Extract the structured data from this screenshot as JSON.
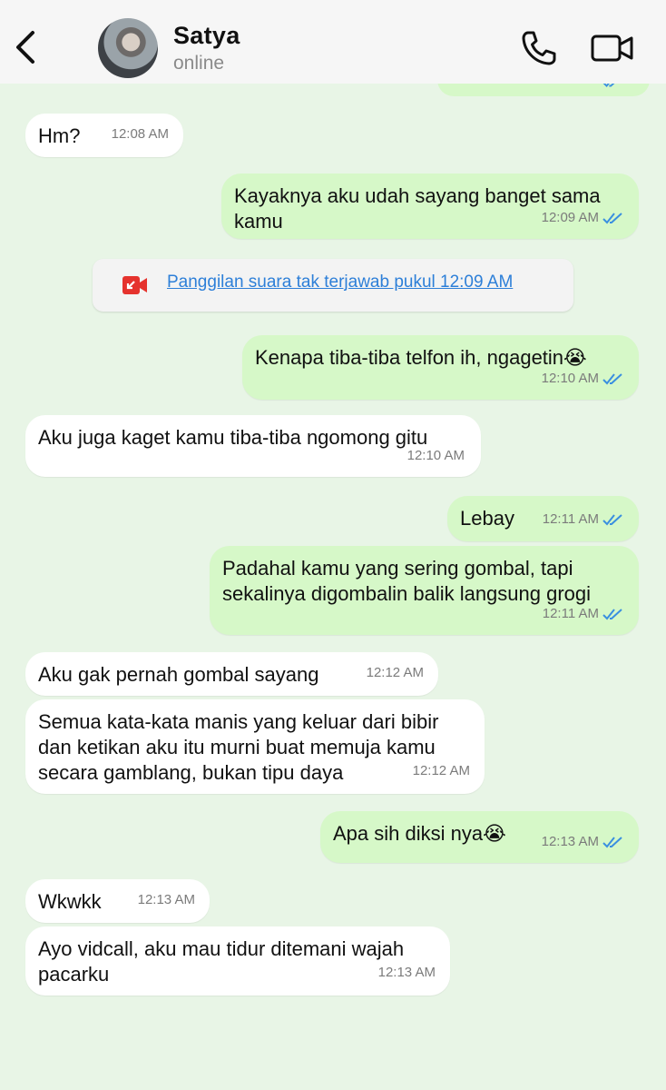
{
  "header": {
    "name": "Satya",
    "status": "online"
  },
  "icons": {
    "back": "chevron-left-icon",
    "call": "phone-icon",
    "video": "video-camera-icon",
    "missed_call": "missed-video-call-icon",
    "read_receipt": "double-check-icon"
  },
  "colors": {
    "incoming_bubble": "#ffffff",
    "outgoing_bubble": "#d6f8c8",
    "background": "#e8f5e6",
    "read_ticks": "#3a8fe0",
    "missed_call_red": "#e5322d",
    "link_blue": "#2d7fd8"
  },
  "call_notice": {
    "text": "Panggilan suara tak terjawab pukul 12:09 AM"
  },
  "messages": [
    {
      "dir": "in",
      "text": "Hm?",
      "time": "12:08 AM"
    },
    {
      "dir": "out",
      "text": "Kayaknya aku udah sayang banget sama\nkamu",
      "time": "12:09 AM",
      "read": true
    },
    {
      "dir": "out",
      "text": "Kenapa tiba-tiba telfon ih, ngagetin😭",
      "time": "12:10 AM",
      "read": true
    },
    {
      "dir": "in",
      "text": "Aku juga kaget kamu tiba-tiba ngomong gitu",
      "time": "12:10 AM"
    },
    {
      "dir": "out",
      "text": "Lebay",
      "time": "12:11 AM",
      "read": true
    },
    {
      "dir": "out",
      "text": "Padahal kamu yang sering gombal, tapi\nsekalinya digombalin balik langsung grogi",
      "time": "12:11 AM",
      "read": true
    },
    {
      "dir": "in",
      "text": "Aku gak pernah gombal sayang",
      "time": "12:12 AM"
    },
    {
      "dir": "in",
      "text": "Semua kata-kata manis yang keluar dari bibir\ndan ketikan aku itu murni buat memuja kamu\nsecara gamblang, bukan tipu daya",
      "time": "12:12 AM"
    },
    {
      "dir": "out",
      "text": "Apa sih diksi nya😭",
      "time": "12:13 AM",
      "read": true
    },
    {
      "dir": "in",
      "text": "Wkwkk",
      "time": "12:13 AM"
    },
    {
      "dir": "in",
      "text": "Ayo vidcall, aku mau tidur ditemani wajah\npacarku",
      "time": "12:13 AM"
    }
  ]
}
